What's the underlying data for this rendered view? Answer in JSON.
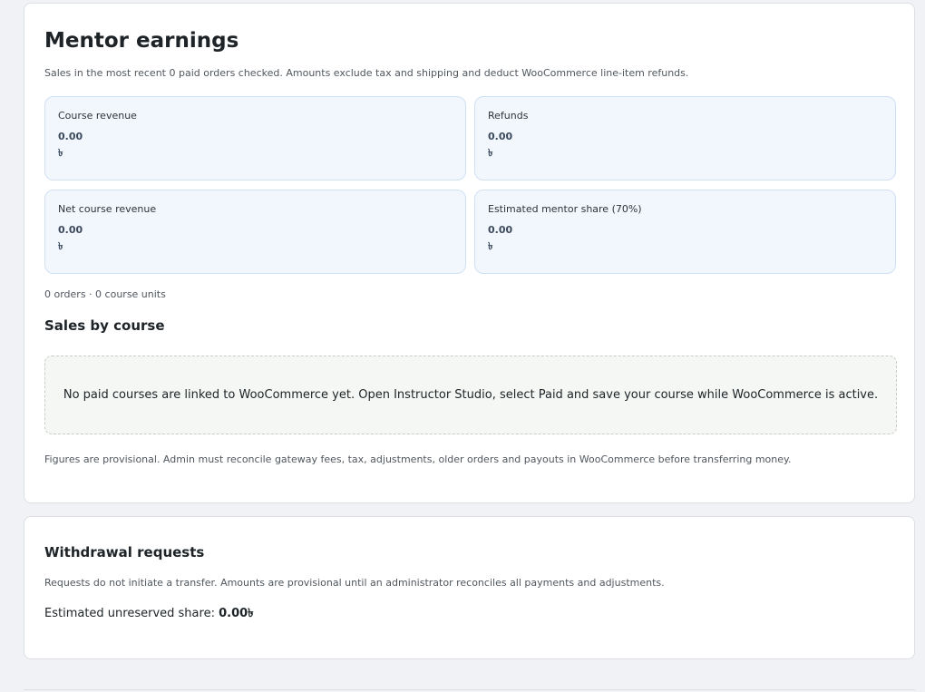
{
  "earnings": {
    "title": "Mentor earnings",
    "intro": "Sales in the most recent 0 paid orders checked. Amounts exclude tax and shipping and deduct WooCommerce line-item refunds.",
    "cards": [
      {
        "label": "Course revenue",
        "value": "0.00",
        "currency": "৳"
      },
      {
        "label": "Refunds",
        "value": "0.00",
        "currency": "৳"
      },
      {
        "label": "Net course revenue",
        "value": "0.00",
        "currency": "৳"
      },
      {
        "label": "Estimated mentor share (70%)",
        "value": "0.00",
        "currency": "৳"
      }
    ],
    "orders_summary": "0 orders · 0 course units",
    "sales_heading": "Sales by course",
    "empty_message": "No paid courses are linked to WooCommerce yet. Open Instructor Studio, select Paid and save your course while WooCommerce is active.",
    "disclaimer": "Figures are provisional. Admin must reconcile gateway fees, tax, adjustments, older orders and payouts in WooCommerce before transferring money."
  },
  "withdrawal": {
    "title": "Withdrawal requests",
    "note": "Requests do not initiate a transfer. Amounts are provisional until an administrator reconciles all payments and adjustments.",
    "estimate_label": "Estimated unreserved share: ",
    "estimate_value": "0.00৳"
  }
}
